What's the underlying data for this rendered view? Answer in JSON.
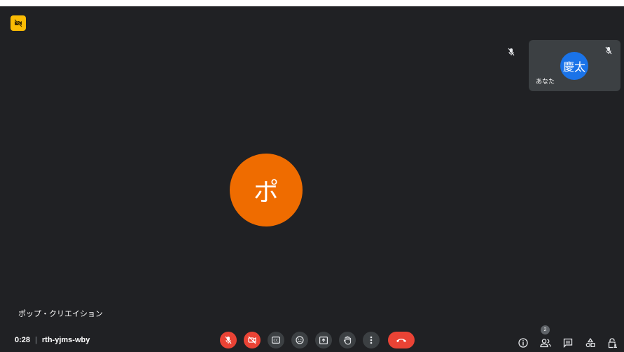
{
  "stage": {
    "recording_icon": "camera-off-icon"
  },
  "self_tile": {
    "avatar_text": "慶太",
    "name": "あなた",
    "mic_icon": "mic-off-icon"
  },
  "main_participant": {
    "avatar_text": "ポ",
    "name": "ポップ・クリエイション"
  },
  "meeting": {
    "time": "0:28",
    "separator": "|",
    "code": "rth-yjms-wby"
  },
  "controls": [
    {
      "name": "mic-toggle-button",
      "icon": "mic-off-icon",
      "state": "off"
    },
    {
      "name": "camera-toggle-button",
      "icon": "camera-off-icon",
      "state": "off"
    },
    {
      "name": "captions-button",
      "icon": "captions-icon"
    },
    {
      "name": "reactions-button",
      "icon": "smiley-icon"
    },
    {
      "name": "present-button",
      "icon": "present-screen-icon"
    },
    {
      "name": "raise-hand-button",
      "icon": "hand-icon"
    },
    {
      "name": "more-options-button",
      "icon": "more-vert-icon"
    },
    {
      "name": "leave-call-button",
      "icon": "hangup-icon"
    }
  ],
  "right_tools": {
    "people_count": "2"
  },
  "colors": {
    "stage_bg": "#202124",
    "tile_bg": "#3c4043",
    "self_avatar": "#1a73e8",
    "main_avatar": "#ef6c00",
    "danger": "#ea4335",
    "recording_badge": "#fbbc04"
  }
}
